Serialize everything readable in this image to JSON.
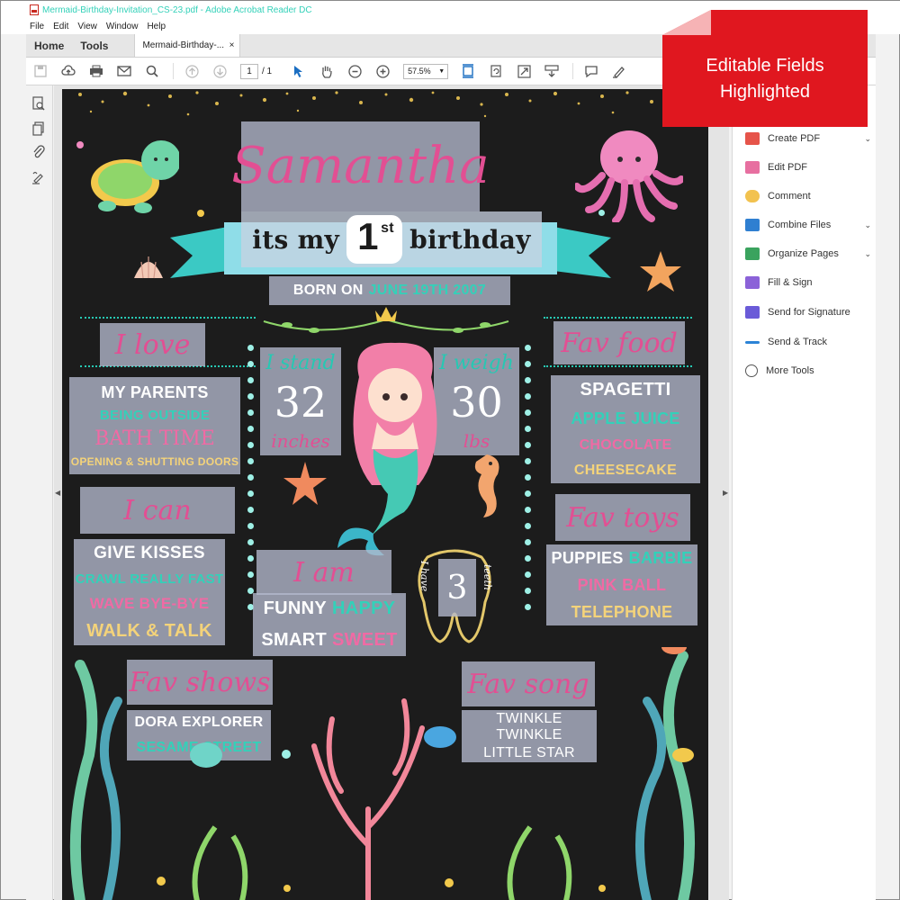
{
  "window": {
    "title": "Mermaid-Birthday-Invitation_CS-23.pdf - Adobe Acrobat Reader DC"
  },
  "menu": [
    "File",
    "Edit",
    "View",
    "Window",
    "Help"
  ],
  "tabs": {
    "home": "Home",
    "tools": "Tools",
    "document": "Mermaid-Birthday-...",
    "close": "×"
  },
  "toolbar": {
    "page_current": "1",
    "page_total": "/ 1",
    "zoom": "57.5%"
  },
  "banner": {
    "line1": "Editable Fields",
    "line2": "Highlighted"
  },
  "tools_panel": [
    {
      "label": "Create PDF",
      "icon": "create-pdf-icon",
      "color": "#e6544a",
      "expandable": true
    },
    {
      "label": "Edit PDF",
      "icon": "edit-pdf-icon",
      "color": "#e76fa0",
      "expandable": false
    },
    {
      "label": "Comment",
      "icon": "comment-icon",
      "color": "#f2c24f",
      "expandable": false
    },
    {
      "label": "Combine Files",
      "icon": "combine-files-icon",
      "color": "#2f7fd1",
      "expandable": true
    },
    {
      "label": "Organize Pages",
      "icon": "organize-pages-icon",
      "color": "#3aa35e",
      "expandable": true
    },
    {
      "label": "Fill & Sign",
      "icon": "fill-sign-icon",
      "color": "#8b62d8",
      "expandable": false
    },
    {
      "label": "Send for Signature",
      "icon": "send-signature-icon",
      "color": "#6a5bd8",
      "expandable": false
    },
    {
      "label": "Send & Track",
      "icon": "send-track-icon",
      "color": "#2b83d6",
      "expandable": false
    },
    {
      "label": "More Tools",
      "icon": "more-tools-icon",
      "color": "#555555",
      "expandable": false
    }
  ],
  "invite": {
    "name": "Samantha",
    "birthday_left": "its my",
    "birthday_num": "1",
    "birthday_sup": "st",
    "birthday_right": "birthday",
    "born_label": "BORN ON",
    "born_date": "JUNE 19TH 2007",
    "i_love": {
      "title": "I love",
      "items": [
        "MY PARENTS",
        "BEING OUTSIDE",
        "BATH TIME",
        "OPENING & SHUTTING DOORS"
      ]
    },
    "fav_food": {
      "title": "Fav food",
      "items": [
        "SPAGETTI",
        "APPLE JUICE",
        "CHOCOLATE",
        "CHEESECAKE"
      ]
    },
    "i_can": {
      "title": "I can",
      "items": [
        "GIVE KISSES",
        "CRAWL REALLY FAST",
        "WAVE BYE-BYE",
        "WALK & TALK"
      ]
    },
    "fav_toys": {
      "title": "Fav toys",
      "items_line1_a": "PUPPIES",
      "items_line1_b": "BARBIE",
      "items": [
        "PINK BALL",
        "TELEPHONE"
      ]
    },
    "stand": {
      "title": "I stand",
      "value": "32",
      "unit": "inches"
    },
    "weigh": {
      "title": "I weigh",
      "value": "30",
      "unit": "lbs"
    },
    "i_am": {
      "title": "I am",
      "line1_a": "FUNNY",
      "line1_b": "HAPPY",
      "line2_a": "SMART",
      "line2_b": "SWEET"
    },
    "teeth": {
      "prefix": "I have",
      "value": "3",
      "suffix": "teeth"
    },
    "fav_shows": {
      "title": "Fav shows",
      "items": [
        "DORA EXPLORER",
        "SESAME STREET"
      ]
    },
    "fav_song": {
      "title": "Fav song",
      "items": [
        "TWINKLE TWINKLE",
        "LITTLE STAR"
      ]
    }
  }
}
